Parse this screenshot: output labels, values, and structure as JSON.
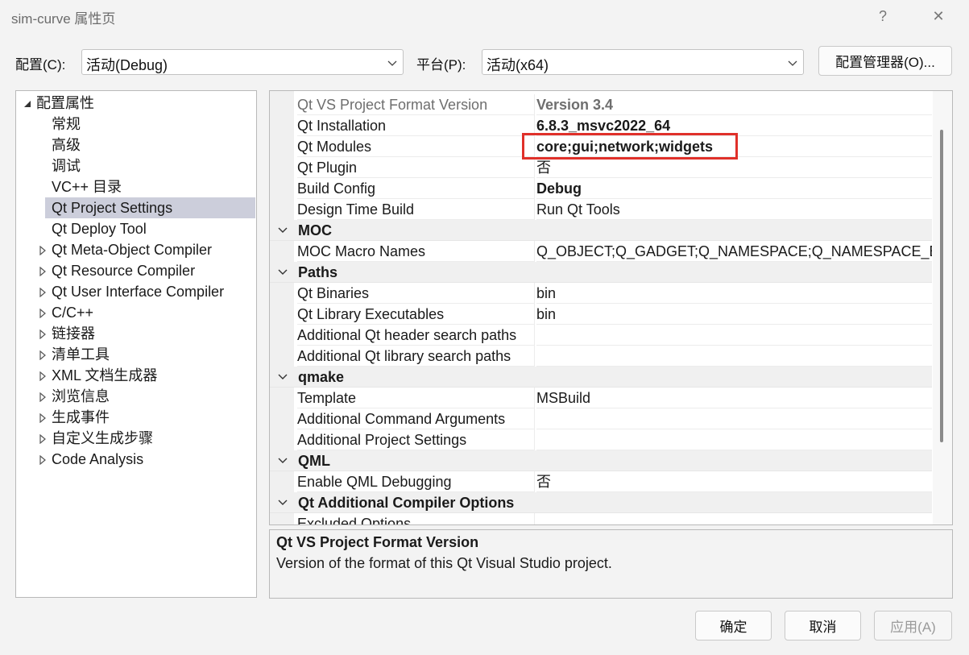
{
  "window": {
    "title": "sim-curve 属性页",
    "help_glyph": "?",
    "close_glyph": "✕"
  },
  "config_bar": {
    "config_label": "配置(C):",
    "config_value": "活动(Debug)",
    "platform_label": "平台(P):",
    "platform_value": "活动(x64)",
    "manager_button": "配置管理器(O)..."
  },
  "tree": {
    "root": "配置属性",
    "items": [
      {
        "label": "常规",
        "expandable": false,
        "selected": false
      },
      {
        "label": "高级",
        "expandable": false,
        "selected": false
      },
      {
        "label": "调试",
        "expandable": false,
        "selected": false
      },
      {
        "label": "VC++ 目录",
        "expandable": false,
        "selected": false
      },
      {
        "label": "Qt Project Settings",
        "expandable": false,
        "selected": true
      },
      {
        "label": "Qt Deploy Tool",
        "expandable": false,
        "selected": false
      },
      {
        "label": "Qt Meta-Object Compiler",
        "expandable": true,
        "selected": false
      },
      {
        "label": "Qt Resource Compiler",
        "expandable": true,
        "selected": false
      },
      {
        "label": "Qt User Interface Compiler",
        "expandable": true,
        "selected": false
      },
      {
        "label": "C/C++",
        "expandable": true,
        "selected": false
      },
      {
        "label": "链接器",
        "expandable": true,
        "selected": false
      },
      {
        "label": "清单工具",
        "expandable": true,
        "selected": false
      },
      {
        "label": "XML 文档生成器",
        "expandable": true,
        "selected": false
      },
      {
        "label": "浏览信息",
        "expandable": true,
        "selected": false
      },
      {
        "label": "生成事件",
        "expandable": true,
        "selected": false
      },
      {
        "label": "自定义生成步骤",
        "expandable": true,
        "selected": false
      },
      {
        "label": "Code Analysis",
        "expandable": true,
        "selected": false
      }
    ]
  },
  "grid": {
    "entries": [
      {
        "kind": "prop",
        "name": "Qt VS Project Format Version",
        "value": "Version 3.4",
        "bold": true,
        "dim": true
      },
      {
        "kind": "prop",
        "name": "Qt Installation",
        "value": "6.8.3_msvc2022_64",
        "bold": true
      },
      {
        "kind": "prop",
        "name": "Qt Modules",
        "value": "core;gui;network;widgets",
        "bold": true
      },
      {
        "kind": "prop",
        "name": "Qt Plugin",
        "value": "否",
        "bold": false
      },
      {
        "kind": "prop",
        "name": "Build Config",
        "value": "Debug",
        "bold": true
      },
      {
        "kind": "prop",
        "name": "Design Time Build",
        "value": "Run Qt Tools",
        "bold": false
      },
      {
        "kind": "category",
        "name": "MOC"
      },
      {
        "kind": "prop",
        "name": "MOC Macro Names",
        "value": "Q_OBJECT;Q_GADGET;Q_NAMESPACE;Q_NAMESPACE_EXPORT",
        "bold": false
      },
      {
        "kind": "category",
        "name": "Paths"
      },
      {
        "kind": "prop",
        "name": "Qt Binaries",
        "value": "bin",
        "bold": false
      },
      {
        "kind": "prop",
        "name": "Qt Library Executables",
        "value": "bin",
        "bold": false
      },
      {
        "kind": "prop",
        "name": "Additional Qt header search paths",
        "value": "",
        "bold": false
      },
      {
        "kind": "prop",
        "name": "Additional Qt library search paths",
        "value": "",
        "bold": false
      },
      {
        "kind": "category",
        "name": "qmake"
      },
      {
        "kind": "prop",
        "name": "Template",
        "value": "MSBuild",
        "bold": false
      },
      {
        "kind": "prop",
        "name": "Additional Command Arguments",
        "value": "",
        "bold": false
      },
      {
        "kind": "prop",
        "name": "Additional Project Settings",
        "value": "",
        "bold": false
      },
      {
        "kind": "category",
        "name": "QML"
      },
      {
        "kind": "prop",
        "name": "Enable QML Debugging",
        "value": "否",
        "bold": false
      },
      {
        "kind": "category",
        "name": "Qt Additional Compiler Options"
      },
      {
        "kind": "prop",
        "name": "Excluded Options",
        "value": "",
        "bold": false
      }
    ]
  },
  "description": {
    "title": "Qt VS Project Format Version",
    "text": "Version of the format of this Qt Visual Studio project."
  },
  "footer": {
    "ok": "确定",
    "cancel": "取消",
    "apply": "应用(A)"
  },
  "colors": {
    "selection": "#cccedb",
    "highlight_box": "#e0302a"
  }
}
